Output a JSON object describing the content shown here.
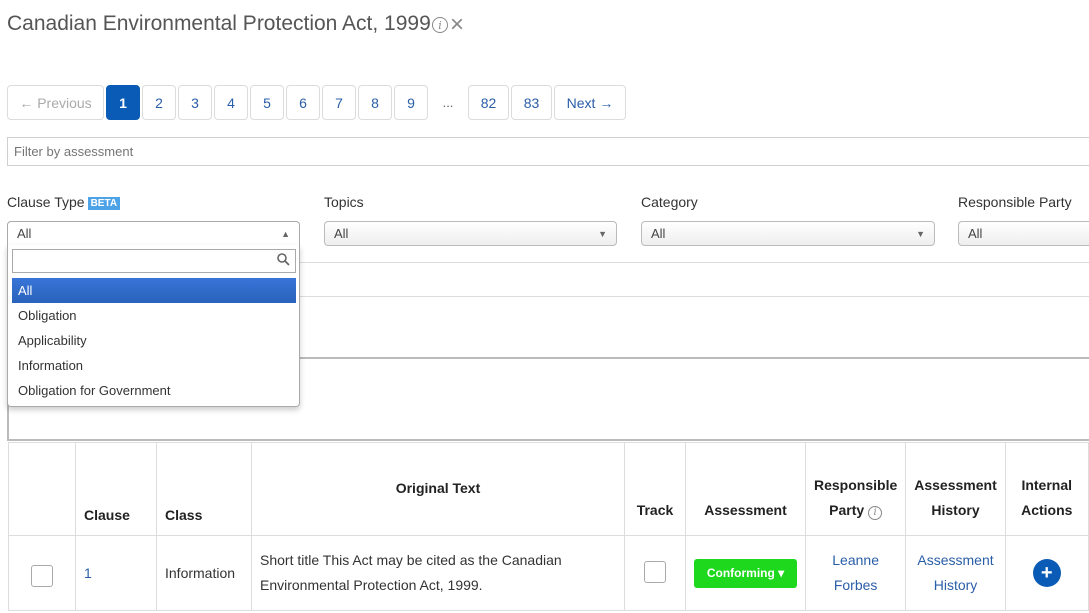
{
  "page": {
    "title": "Canadian Environmental Protection Act, 1999",
    "info_glyph": "i",
    "close_glyph": "×"
  },
  "pagination": {
    "prev_label": "← Previous",
    "pages": [
      "1",
      "2",
      "3",
      "4",
      "5",
      "6",
      "7",
      "8",
      "9"
    ],
    "ellipsis": "...",
    "last_pages": [
      "82",
      "83"
    ],
    "next_label": "Next →",
    "current": "1"
  },
  "filter": {
    "placeholder": "Filter by assessment"
  },
  "filters": {
    "clause_type": {
      "label": "Clause Type",
      "badge": "BETA",
      "value": "All"
    },
    "topics": {
      "label": "Topics",
      "value": "All"
    },
    "category": {
      "label": "Category",
      "value": "All"
    },
    "responsible_party": {
      "label": "Responsible Party",
      "value": "All"
    }
  },
  "dropdown": {
    "options": [
      "All",
      "Obligation",
      "Applicability",
      "Information",
      "Obligation for Government"
    ],
    "highlighted": "All"
  },
  "table": {
    "headers": {
      "clause": "Clause",
      "class": "Class",
      "original_text": "Original Text",
      "track": "Track",
      "assessment": "Assessment",
      "responsible_party_1": "Responsible",
      "responsible_party_2": "Party",
      "assessment_history_1": "Assessment",
      "assessment_history_2": "History",
      "internal_actions_1": "Internal",
      "internal_actions_2": "Actions"
    },
    "rows": [
      {
        "clause": "1",
        "class": "Information",
        "original_text_1": "Short title This Act may be cited as the Canadian",
        "original_text_2": "Environmental Protection Act, 1999.",
        "assessment": "Conforming ▾",
        "responsible_party_1": "Leanne",
        "responsible_party_2": "Forbes",
        "history_1": "Assessment",
        "history_2": "History",
        "action": "+"
      }
    ]
  },
  "colors": {
    "primary": "#0a5bb5",
    "link": "#2a5ea8",
    "conforming": "#1ed81e",
    "beta_badge": "#4da3e8",
    "highlight": "#3875d7"
  }
}
